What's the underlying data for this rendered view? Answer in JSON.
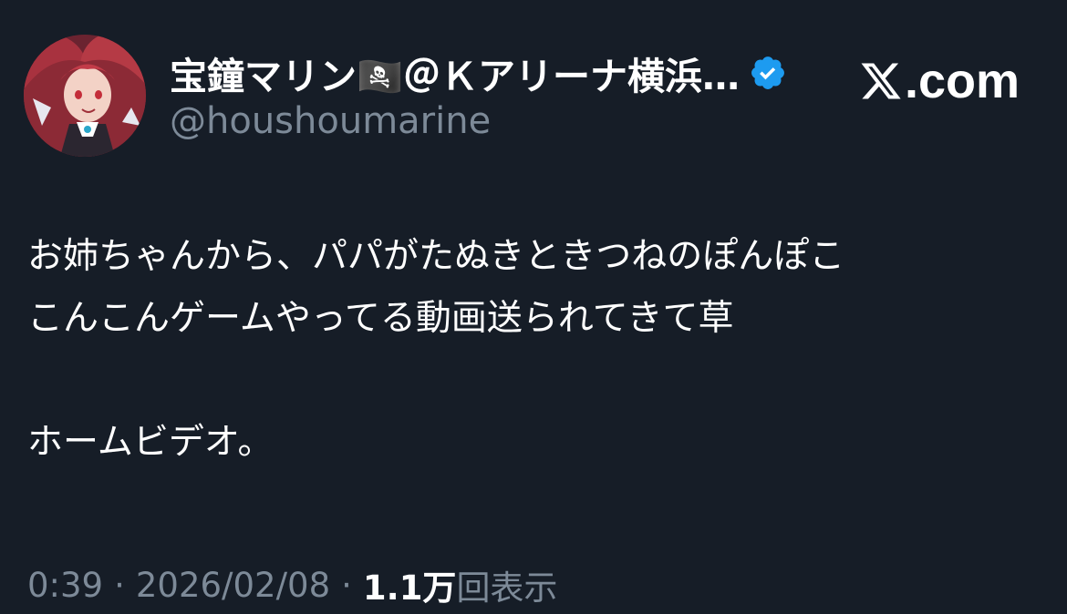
{
  "author": {
    "display_name": "宝鐘マリン🏴‍☠️＠Ｋアリーナ横浜…",
    "handle": "@houshoumarine",
    "verified": true,
    "avatar_icon": "avatar-image"
  },
  "site": {
    "logo_icon": "x-logo-icon",
    "domain": ".com"
  },
  "tweet": {
    "lines": [
      "お姉ちゃんから、パパがたぬきときつねのぽんぽこ",
      "こんこんゲームやってる動画送られてきて草",
      "",
      "ホームビデオ。"
    ]
  },
  "meta": {
    "time": "0:39",
    "separator": "·",
    "date": "2026/02/08",
    "views_count": "1.1万",
    "views_label": "回表示"
  },
  "colors": {
    "background": "#161d27",
    "text_primary": "#ffffff",
    "text_secondary": "#7d8a98",
    "verified_blue": "#1d9bf0"
  }
}
